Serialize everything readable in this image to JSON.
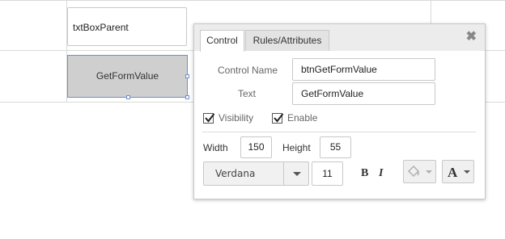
{
  "designer": {
    "textbox_label": "txtBoxParent",
    "button_label": "GetFormValue"
  },
  "panel": {
    "tabs": [
      {
        "label": "Control",
        "active": true
      },
      {
        "label": "Rules/Attributes",
        "active": false
      }
    ],
    "close_icon": "close-x-icon",
    "control_name_label": "Control Name",
    "control_name_value": "btnGetFormValue",
    "text_label": "Text",
    "text_value": "GetFormValue",
    "visibility_label": "Visibility",
    "visibility_checked": true,
    "enable_label": "Enable",
    "enable_checked": true,
    "width_label": "Width",
    "width_value": "150",
    "height_label": "Height",
    "height_value": "55",
    "font_family": "Verdana",
    "font_size": "11",
    "bold_label": "B",
    "italic_label": "I",
    "colors": {
      "accent_border": "#6d8fcf",
      "button_fill": "#cfcfcf"
    }
  }
}
